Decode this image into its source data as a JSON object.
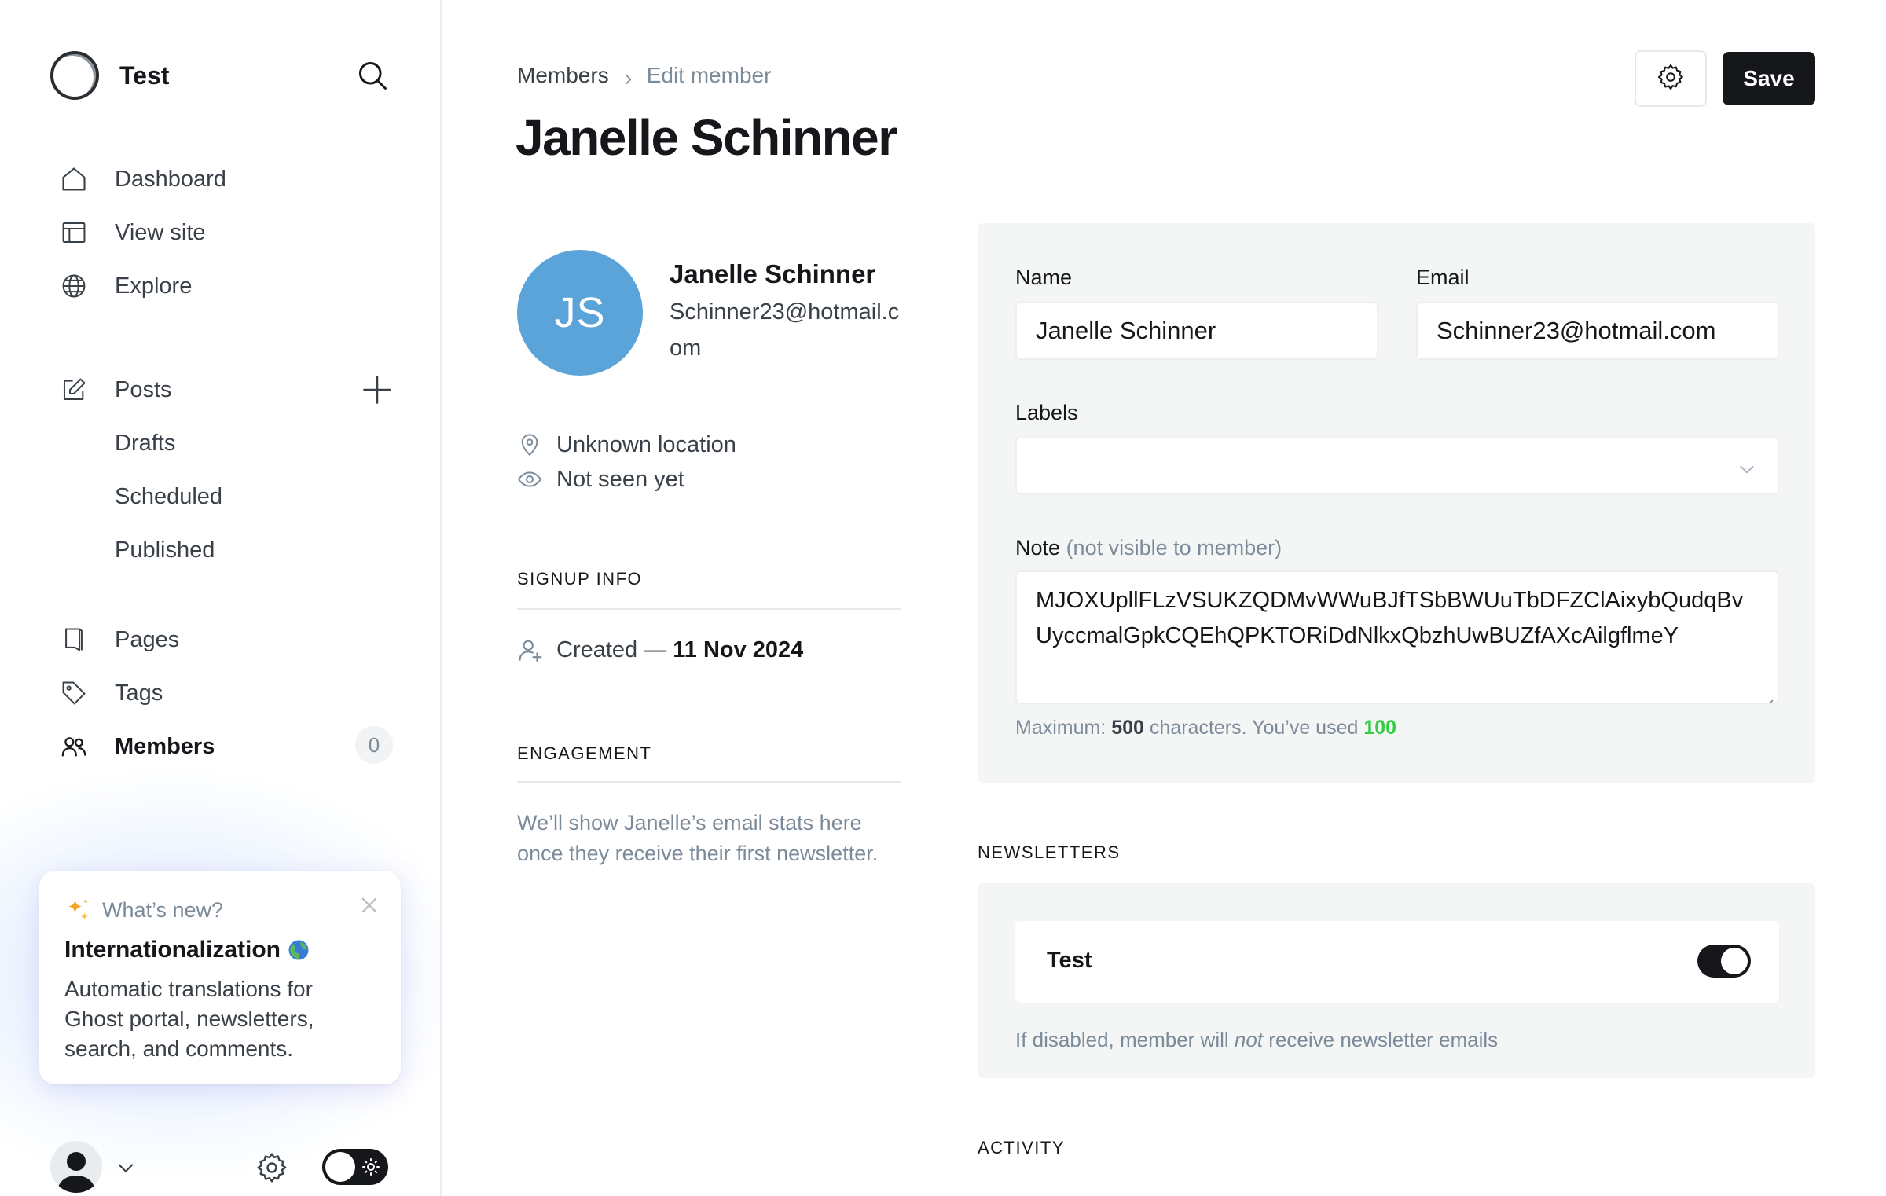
{
  "sidebar": {
    "brand": "Test",
    "nav": {
      "dashboard": "Dashboard",
      "view_site": "View site",
      "explore": "Explore",
      "posts": "Posts",
      "drafts": "Drafts",
      "scheduled": "Scheduled",
      "published": "Published",
      "pages": "Pages",
      "tags": "Tags",
      "members": "Members",
      "members_count": "0"
    },
    "whats_new": {
      "heading": "What’s new?",
      "title": "Internationalization",
      "body": "Automatic translations for Ghost portal, newsletters, search, and comments."
    }
  },
  "header": {
    "breadcrumb_parent": "Members",
    "breadcrumb_current": "Edit member",
    "title": "Janelle Schinner",
    "save_label": "Save"
  },
  "profile": {
    "initials": "JS",
    "name": "Janelle Schinner",
    "email": "Schinner23@hotmail.com",
    "location": "Unknown location",
    "last_seen": "Not seen yet",
    "signup_heading": "SIGNUP INFO",
    "created_label": "Created —",
    "created_date": "11 Nov 2024",
    "engagement_heading": "ENGAGEMENT",
    "engagement_text": "We’ll show Janelle’s email stats here once they receive their first newsletter."
  },
  "form": {
    "name_label": "Name",
    "name_value": "Janelle Schinner",
    "email_label": "Email",
    "email_value": "Schinner23@hotmail.com",
    "labels_label": "Labels",
    "note_label": "Note",
    "note_sublabel": "(not visible to member)",
    "note_value": "MJOXUpllFLzVSUKZQDMvWWuBJfTSbBWUuTbDFZClAixybQudqBvUyccmalGpkCQEhQPKTORiDdNlkxQbzhUwBUZfAXcAilgflmeY",
    "hint_prefix": "Maximum:",
    "hint_max": "500",
    "hint_middle": "characters. You’ve used",
    "hint_used": "100"
  },
  "newsletters": {
    "heading": "NEWSLETTERS",
    "items": [
      {
        "name": "Test",
        "enabled": true
      }
    ],
    "hint_prefix": "If disabled, member will",
    "hint_em": "not",
    "hint_suffix": "receive newsletter emails"
  },
  "activity": {
    "heading": "ACTIVITY"
  },
  "colors": {
    "accent_dark": "#15171a",
    "avatar_blue": "#5ba4d9",
    "used_green": "#30cf43",
    "muted": "#7c8b9a"
  },
  "icons": [
    "ghost-logo-icon",
    "search-icon",
    "home-icon",
    "layout-icon",
    "globe-icon",
    "edit-icon",
    "plus-icon",
    "page-icon",
    "tag-icon",
    "members-icon",
    "sparkle-icon",
    "close-icon",
    "user-avatar-icon",
    "chevron-down-icon",
    "gear-icon",
    "sun-icon",
    "chevron-right-icon",
    "location-pin-icon",
    "eye-icon",
    "user-plus-icon"
  ]
}
